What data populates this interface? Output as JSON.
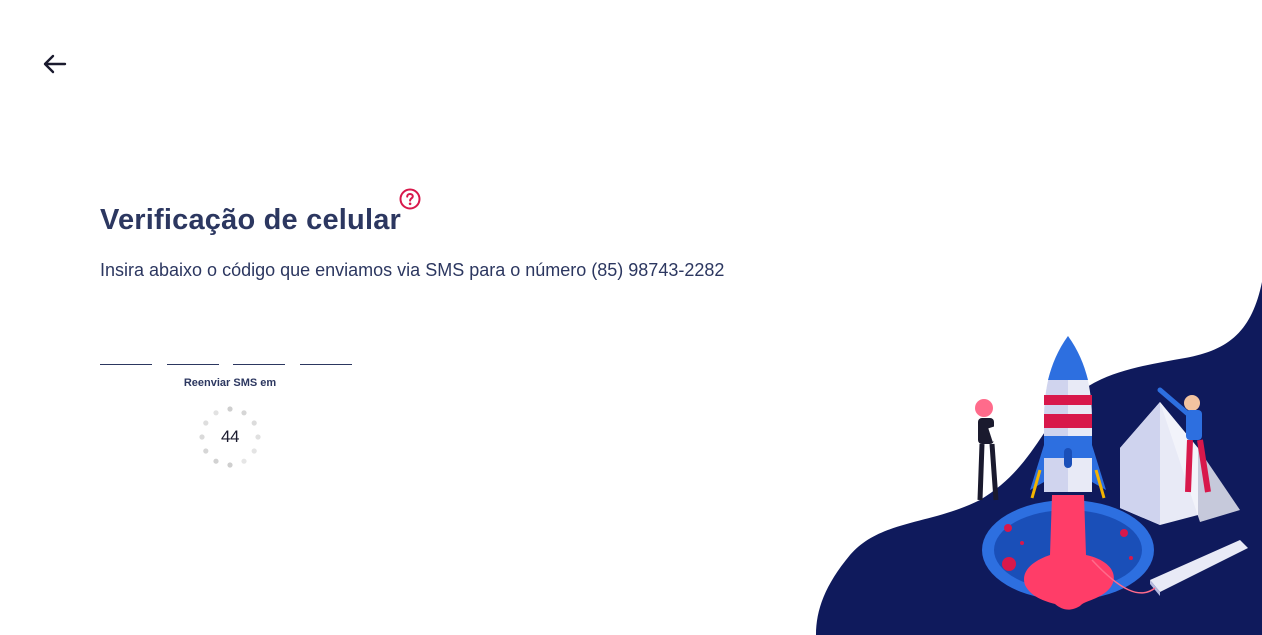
{
  "nav": {
    "back_icon": "arrow-left-icon"
  },
  "header": {
    "title": "Verificação de celular",
    "help_icon": "question-circle-icon"
  },
  "instructions": {
    "text": "Insira abaixo o código que enviamos via SMS para o número (85) 98743-2282"
  },
  "code": {
    "digits": [
      "",
      "",
      "",
      ""
    ]
  },
  "resend": {
    "label": "Reenviar SMS em",
    "seconds": "44"
  },
  "colors": {
    "primary_text": "#2c3760",
    "accent": "#d8184b",
    "illustration_bg": "#0f1a5c"
  },
  "illustration": {
    "icon": "rocket-launch-illustration"
  }
}
